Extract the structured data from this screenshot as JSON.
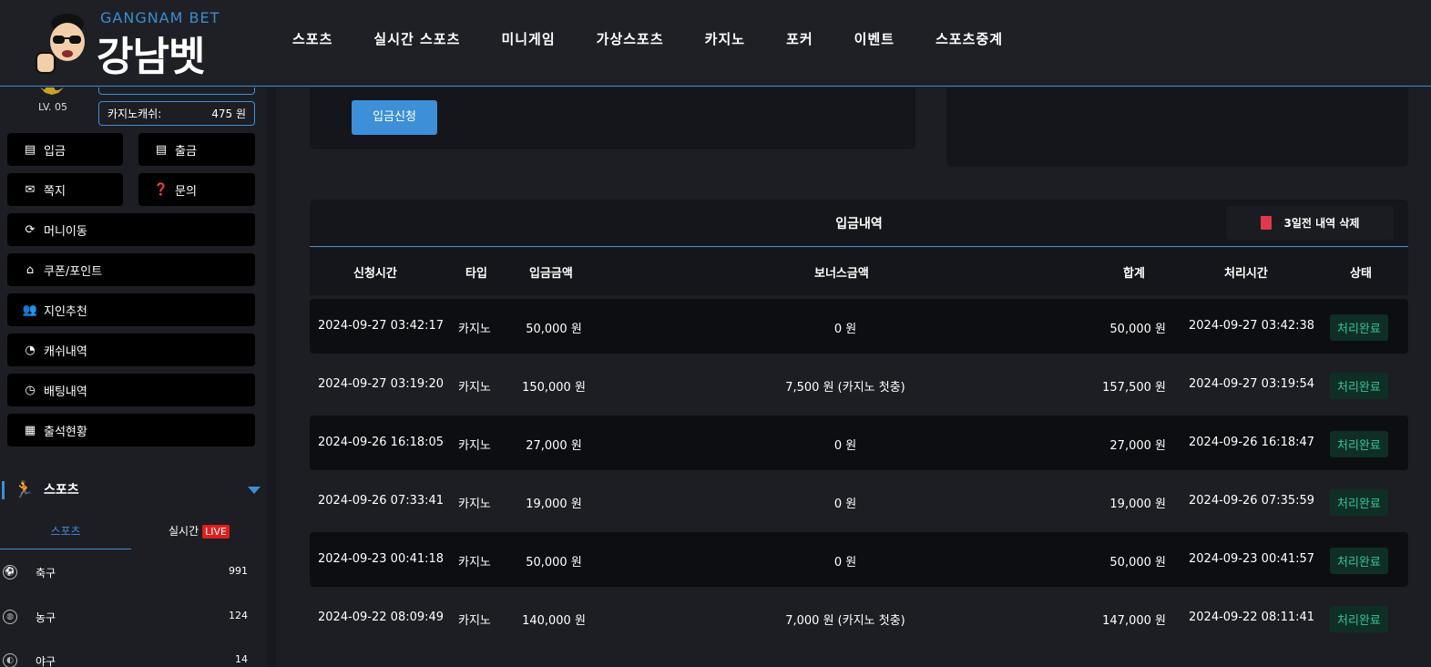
{
  "brand": {
    "en": "GANGNAM BET",
    "ko": "강남벳"
  },
  "nav": [
    "스포츠",
    "실시간 스포츠",
    "미니게임",
    "가상스포츠",
    "카지노",
    "포커",
    "이벤트",
    "스포츠중계"
  ],
  "user": {
    "level": "LV. 05",
    "casino_cash_label": "카지노캐쉬:",
    "casino_cash_value": "475 원"
  },
  "menu": {
    "deposit": "입금",
    "withdraw": "출금",
    "message": "쪽지",
    "inquiry": "문의",
    "money_transfer": "머니이동",
    "coupon_point": "쿠폰/포인트",
    "referral": "지인추천",
    "cash_history": "캐쉬내역",
    "bet_history": "배팅내역",
    "attendance": "출석현황"
  },
  "sports": {
    "title": "스포츠",
    "tab_sports": "스포츠",
    "tab_live": "실시간",
    "live_badge": "LIVE",
    "items": [
      {
        "name": "축구",
        "count": "991"
      },
      {
        "name": "농구",
        "count": "124"
      },
      {
        "name": "야구",
        "count": "14"
      }
    ]
  },
  "deposit_request_button": "입금신청",
  "history": {
    "title": "입금내역",
    "delete_button": "3일전 내역 삭제",
    "columns": [
      "신청시간",
      "타입",
      "입금금액",
      "보너스금액",
      "합계",
      "처리시간",
      "상태"
    ],
    "rows": [
      {
        "requested": "2024-09-27 03:42:17",
        "type": "카지노",
        "amount": "50,000 원",
        "bonus": "0 원",
        "total": "50,000 원",
        "processed": "2024-09-27 03:42:38",
        "status": "처리완료"
      },
      {
        "requested": "2024-09-27 03:19:20",
        "type": "카지노",
        "amount": "150,000 원",
        "bonus": "7,500 원 (카지노 첫충)",
        "total": "157,500 원",
        "processed": "2024-09-27 03:19:54",
        "status": "처리완료"
      },
      {
        "requested": "2024-09-26 16:18:05",
        "type": "카지노",
        "amount": "27,000 원",
        "bonus": "0 원",
        "total": "27,000 원",
        "processed": "2024-09-26 16:18:47",
        "status": "처리완료"
      },
      {
        "requested": "2024-09-26 07:33:41",
        "type": "카지노",
        "amount": "19,000 원",
        "bonus": "0 원",
        "total": "19,000 원",
        "processed": "2024-09-26 07:35:59",
        "status": "처리완료"
      },
      {
        "requested": "2024-09-23 00:41:18",
        "type": "카지노",
        "amount": "50,000 원",
        "bonus": "0 원",
        "total": "50,000 원",
        "processed": "2024-09-23 00:41:57",
        "status": "처리완료"
      },
      {
        "requested": "2024-09-22 08:09:49",
        "type": "카지노",
        "amount": "140,000 원",
        "bonus": "7,000 원 (카지노 첫충)",
        "total": "147,000 원",
        "processed": "2024-09-22 08:11:41",
        "status": "처리완료"
      }
    ]
  },
  "colors": {
    "accent": "#3d8fd8",
    "status_green": "#36c597",
    "live_red": "#e01e1e",
    "danger": "#e0394b"
  }
}
